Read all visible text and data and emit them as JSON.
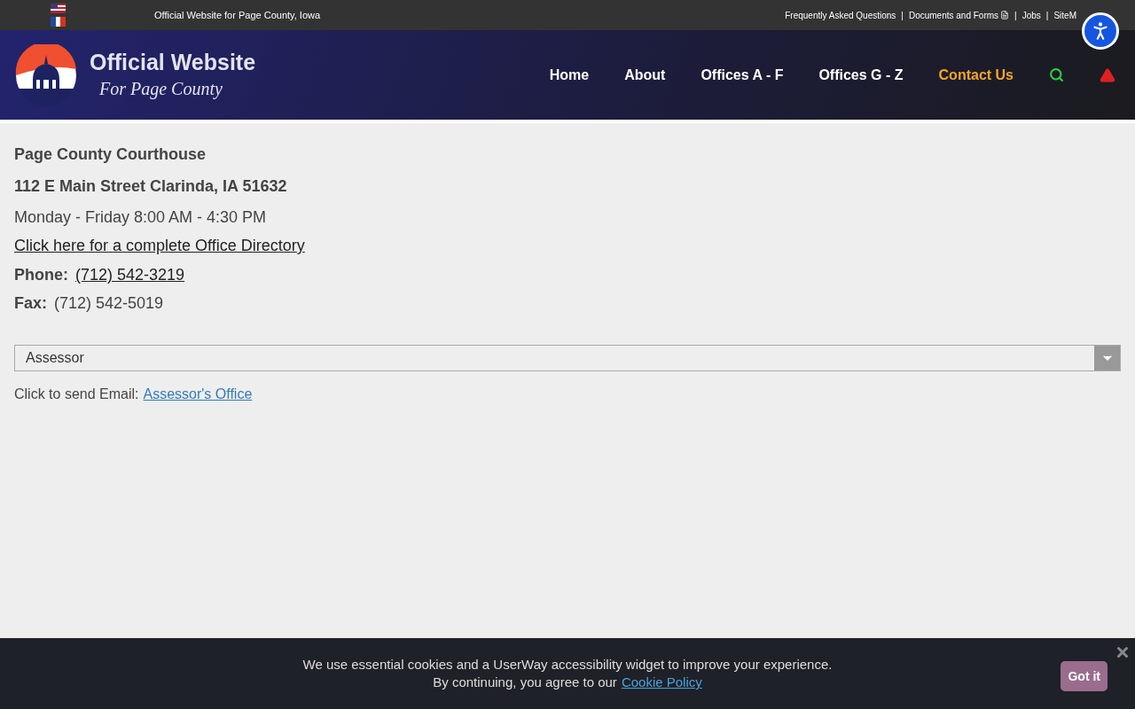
{
  "top_bar": {
    "tagline": "Official Website for Page County, Iowa",
    "links": [
      {
        "label": "Frequently Asked Questions",
        "kind": "text"
      },
      {
        "label": "|",
        "kind": "separator"
      },
      {
        "label": "Documents and Forms",
        "kind": "document"
      },
      {
        "label": "|",
        "kind": "separator"
      },
      {
        "label": "Jobs",
        "kind": "text"
      },
      {
        "label": "|",
        "kind": "separator"
      },
      {
        "label": "SiteM",
        "kind": "text"
      }
    ]
  },
  "header": {
    "title": "Official Website",
    "subtitle": "For Page County",
    "nav": [
      {
        "label": "Home",
        "selected": false
      },
      {
        "label": "About",
        "selected": false
      },
      {
        "label": "Offices A - F",
        "selected": false
      },
      {
        "label": "Offices G - Z",
        "selected": false
      },
      {
        "label": "Contact Us",
        "selected": true
      }
    ]
  },
  "contact": {
    "name": "Page County Courthouse",
    "address": "112 E Main Street Clarinda, IA 51632",
    "hours": "Monday - Friday 8:00 AM - 4:30 PM",
    "directory_link": "Click here for a complete Office Directory",
    "phone_label": "Phone:",
    "phone": "(712) 542-3219",
    "fax_label": "Fax:",
    "fax": "(712) 542-5019"
  },
  "office_select": {
    "value": "Assessor"
  },
  "email": {
    "label": "Click to send Email:",
    "link": "Assessor's Office"
  },
  "cookie_banner": {
    "line_1": "We use essential cookies and a UserWay accessibility widget to improve your experience.",
    "line_2": "By continuing, you agree to our",
    "link": "Cookie Policy",
    "button": "Got it"
  }
}
